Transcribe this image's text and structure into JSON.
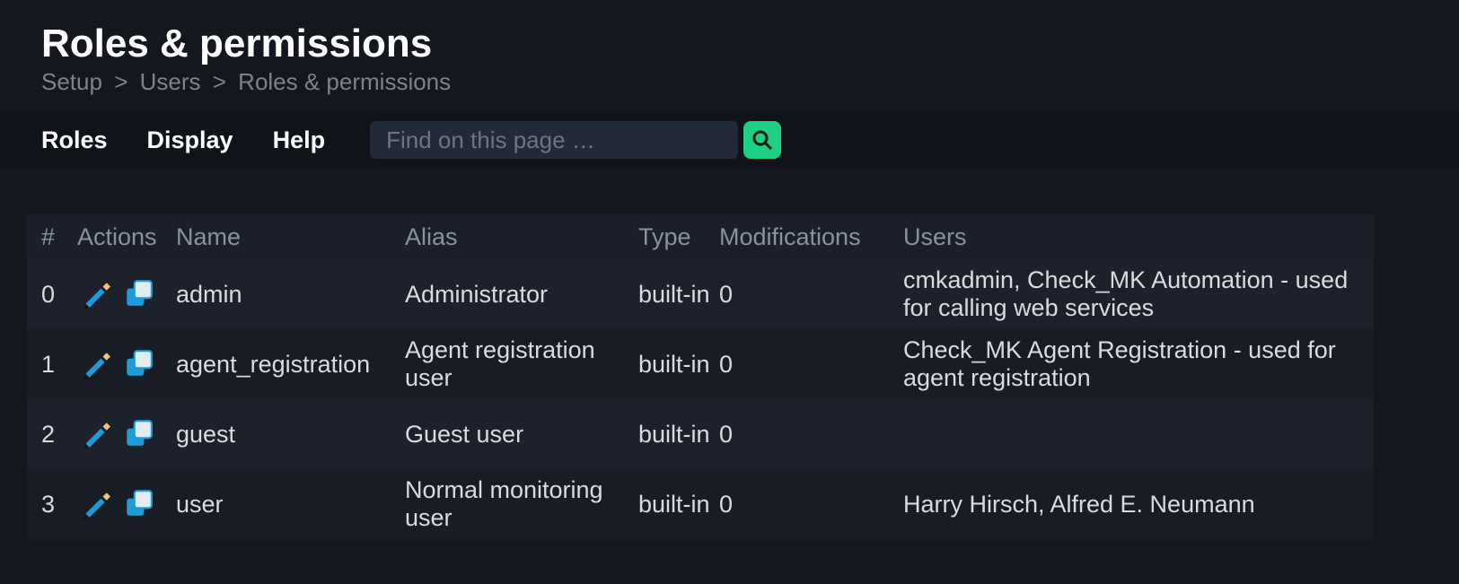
{
  "header": {
    "title": "Roles & permissions",
    "breadcrumb": [
      "Setup",
      "Users",
      "Roles & permissions"
    ]
  },
  "toolbar": {
    "menu": {
      "roles": "Roles",
      "display": "Display",
      "help": "Help"
    },
    "search_placeholder": "Find on this page …"
  },
  "table": {
    "columns": {
      "idx": "#",
      "actions": "Actions",
      "name": "Name",
      "alias": "Alias",
      "type": "Type",
      "modifications": "Modifications",
      "users": "Users"
    },
    "rows": [
      {
        "idx": "0",
        "name": "admin",
        "alias": "Administrator",
        "type": "built-in",
        "modifications": "0",
        "users": "cmkadmin, Check_MK Automation - used for calling web services"
      },
      {
        "idx": "1",
        "name": "agent_registration",
        "alias": "Agent registration user",
        "type": "built-in",
        "modifications": "0",
        "users": "Check_MK Agent Registration - used for agent registration"
      },
      {
        "idx": "2",
        "name": "guest",
        "alias": "Guest user",
        "type": "built-in",
        "modifications": "0",
        "users": ""
      },
      {
        "idx": "3",
        "name": "user",
        "alias": "Normal monitoring user",
        "type": "built-in",
        "modifications": "0",
        "users": "Harry Hirsch, Alfred E. Neumann"
      }
    ]
  }
}
